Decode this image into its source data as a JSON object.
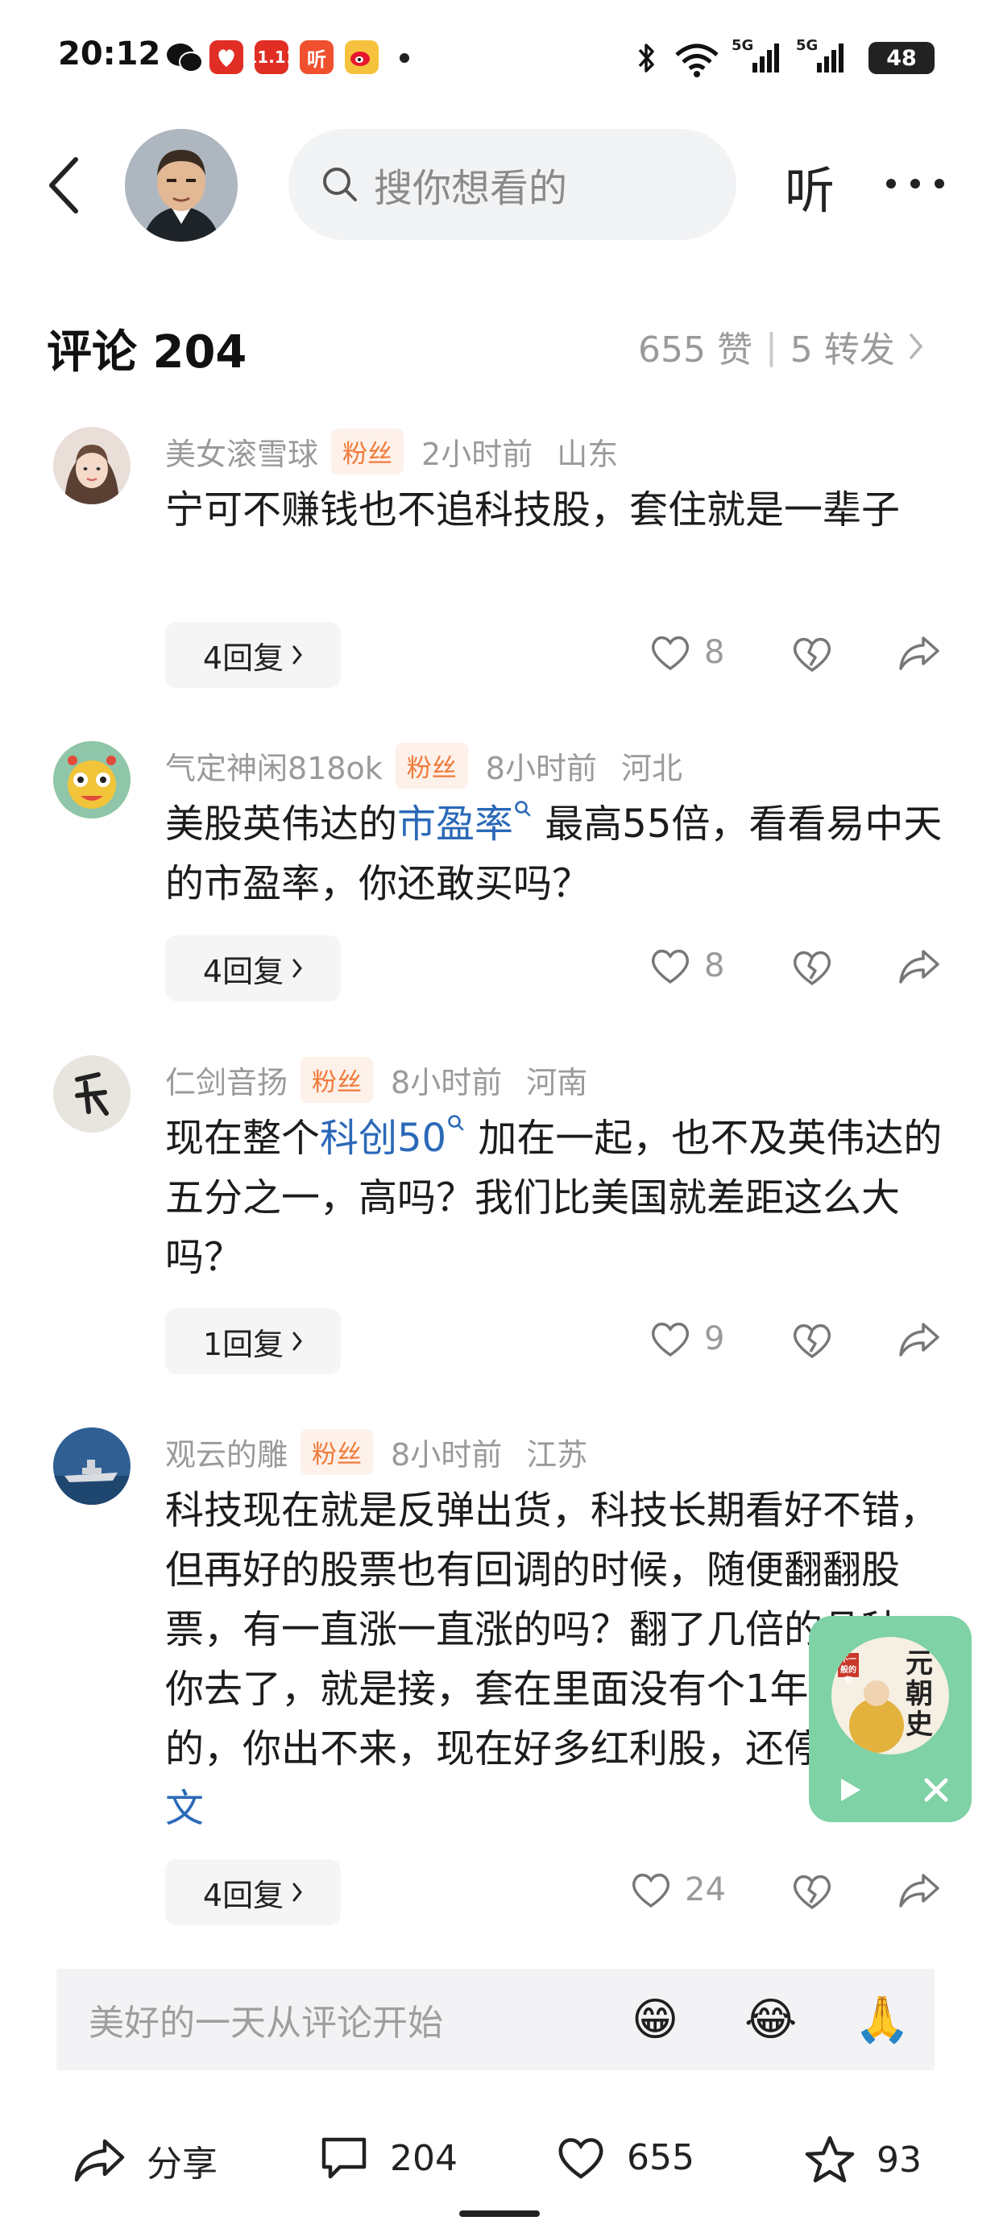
{
  "status_bar": {
    "time": "20:12",
    "battery": "48",
    "signal_1": "5G",
    "signal_2": "5G",
    "app_badge_1": "11.11",
    "app_badge_2": "听"
  },
  "nav": {
    "search_placeholder": "搜你想看的",
    "listen_label": "听"
  },
  "comments_header": {
    "title": "评论 204",
    "likes": "655 赞",
    "separator": "|",
    "shares": "5 转发"
  },
  "comments": [
    {
      "user": "美女滚雪球",
      "badge": "粉丝",
      "time": "2小时前",
      "location": "山东",
      "text": "宁可不赚钱也不追科技股，套住就是一辈子",
      "replies": "4回复",
      "likes": "8"
    },
    {
      "user": "气定神闲818ok",
      "badge": "粉丝",
      "time": "8小时前",
      "location": "河北",
      "text_before": "美股英伟达的",
      "link": "市盈率",
      "text_after": " 最高55倍，看看易中天的市盈率，你还敢买吗？",
      "replies": "4回复",
      "likes": "8"
    },
    {
      "user": "仁剑音扬",
      "badge": "粉丝",
      "time": "8小时前",
      "location": "河南",
      "text_before": "现在整个",
      "link": "科创50",
      "text_after": " 加在一起，也不及英伟达的五分之一，高吗？我们比美国就差距这么大吗？",
      "replies": "1回复",
      "likes": "9"
    },
    {
      "user": "观云的雕",
      "badge": "粉丝",
      "time": "8小时前",
      "location": "江苏",
      "text": "科技现在就是反弹出货，科技长期看好不错，但再好的股票也有回调的时候，随便翻翻股票，有一直涨一直涨的吗？翻了几倍的品种，你去了，就是接，套在里面没有个1年半载的，你出不来，现在好多红利股，还停留...",
      "more_link": "全文",
      "replies": "4回复",
      "likes": "24"
    }
  ],
  "floating_card": {
    "title": "元朝史",
    "badge": "不一般的有"
  },
  "comment_input": {
    "placeholder": "美好的一天从评论开始",
    "emojis": [
      "😁",
      "😂",
      "🙏"
    ]
  },
  "bottom_bar": {
    "share_label": "分享",
    "comments_count": "204",
    "likes_count": "655",
    "favorites_count": "93"
  },
  "colors": {
    "link": "#2b69b8",
    "badge_text": "#f07a3a",
    "badge_bg": "#fdf1ea",
    "float_card": "#7fd1a6"
  }
}
